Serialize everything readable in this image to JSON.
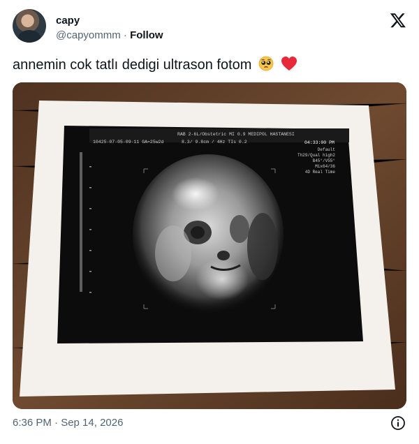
{
  "author": {
    "name": "capy",
    "handle": "@capyommm",
    "separator": "·",
    "follow_label": "Follow"
  },
  "tweet": {
    "text": "annemin cok tatlı dedigi ultrason fotom",
    "emojis": [
      "pleading-face",
      "red-heart"
    ]
  },
  "ultrasound": {
    "header_left": "10425-07-05-09-11  GA=25w2d",
    "line1": "RAB 2-6L/Obstetric    MI 0.9   MEDIPOL HASTANESI",
    "line2": "8.3/ 9.8cm / 4Hz     TIs 0.2",
    "clock": "04:33:00 PM",
    "settings": [
      "Default",
      "Th29/Qual high2",
      "B45°/V55°",
      "Mix64/36",
      "4D Real Time"
    ]
  },
  "footer": {
    "timestamp": "6:36 PM · Sep 14, 2026"
  },
  "icons": {
    "platform": "x-logo-icon",
    "info": "info-icon"
  },
  "colors": {
    "text": "#0f1419",
    "secondary": "#536471",
    "heart": "#e8293a"
  }
}
